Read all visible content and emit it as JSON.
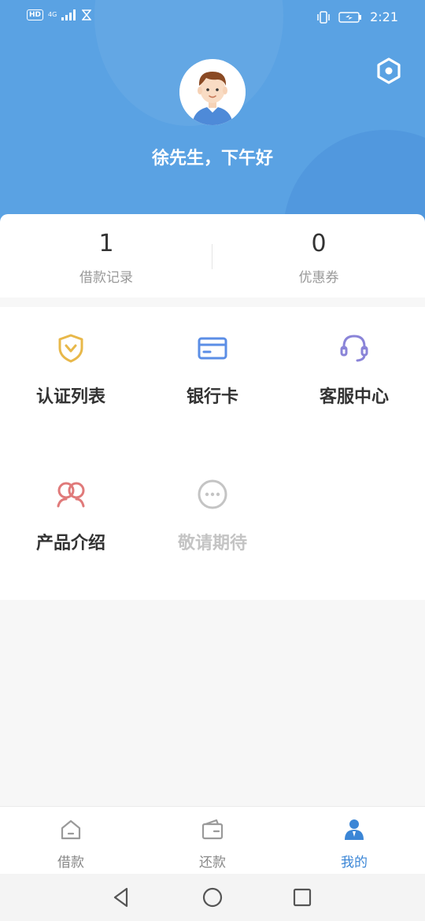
{
  "status_bar": {
    "hd": "HD",
    "network": "4G",
    "time": "2:21"
  },
  "profile": {
    "greeting": "徐先生，下午好"
  },
  "stats": [
    {
      "value": "1",
      "label": "借款记录"
    },
    {
      "value": "0",
      "label": "优惠券"
    }
  ],
  "menu": [
    {
      "label": "认证列表",
      "icon": "shield-check-icon",
      "color": "#e8b84a"
    },
    {
      "label": "银行卡",
      "icon": "bank-card-icon",
      "color": "#5b8ee6"
    },
    {
      "label": "客服中心",
      "icon": "headset-icon",
      "color": "#8a84d8"
    },
    {
      "label": "产品介绍",
      "icon": "people-icon",
      "color": "#e07a7a"
    },
    {
      "label": "敬请期待",
      "icon": "more-icon",
      "color": "#c4c4c4"
    }
  ],
  "tabs": [
    {
      "label": "借款",
      "icon": "home-icon",
      "active": false
    },
    {
      "label": "还款",
      "icon": "wallet-icon",
      "active": false
    },
    {
      "label": "我的",
      "icon": "user-icon",
      "active": true
    }
  ],
  "colors": {
    "header": "#5aa2e3",
    "active_tab": "#3b86d6"
  }
}
